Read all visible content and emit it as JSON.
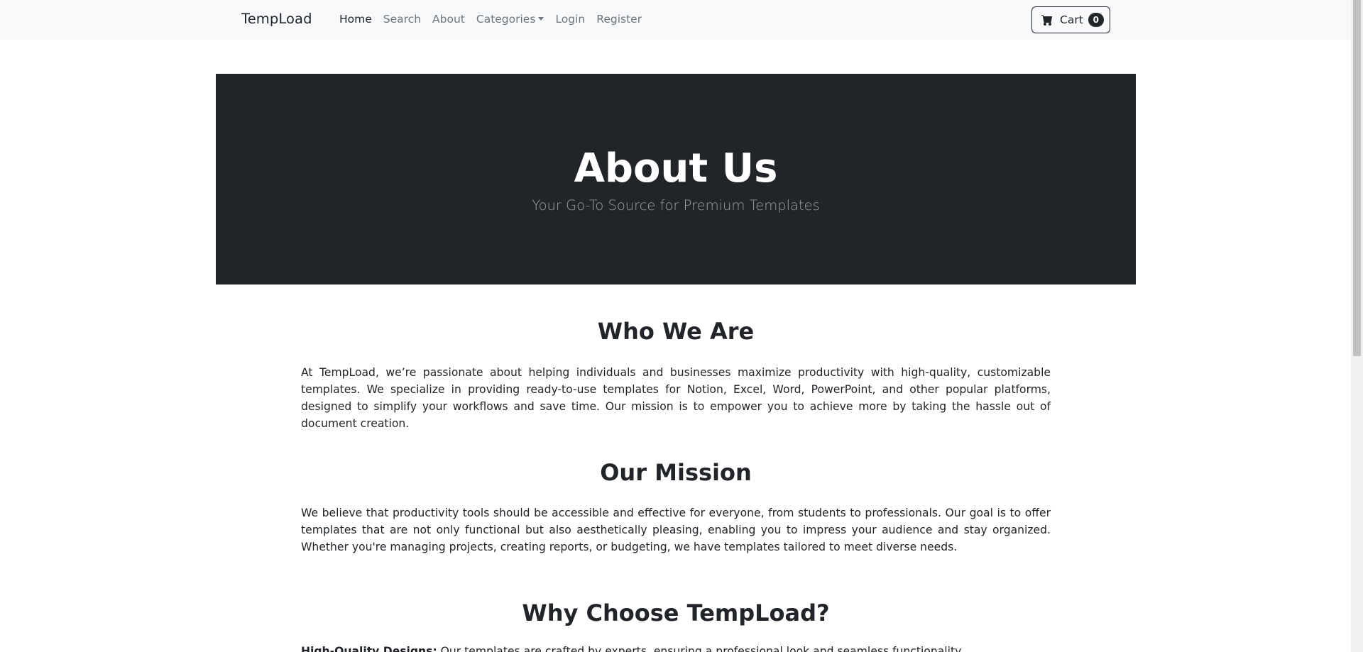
{
  "navbar": {
    "brand": "TempLoad",
    "links": [
      {
        "label": "Home",
        "active": true
      },
      {
        "label": "Search",
        "active": false
      },
      {
        "label": "About",
        "active": false
      },
      {
        "label": "Categories",
        "active": false,
        "dropdown": true
      },
      {
        "label": "Login",
        "active": false
      },
      {
        "label": "Register",
        "active": false
      }
    ],
    "cart": {
      "label": "Cart",
      "count": "0",
      "icon": "cart-icon"
    }
  },
  "hero": {
    "title": "About Us",
    "subtitle": "Your Go-To Source for Premium Templates"
  },
  "sections": [
    {
      "heading": "Who We Are",
      "text": "At TempLoad, we’re passionate about helping individuals and businesses maximize productivity with high-quality, customizable templates. We specialize in providing ready-to-use templates for Notion, Excel, Word, PowerPoint, and other popular platforms, designed to simplify your workflows and save time. Our mission is to empower you to achieve more by taking the hassle out of document creation."
    },
    {
      "heading": "Our Mission",
      "text": "We believe that productivity tools should be accessible and effective for everyone, from students to professionals. Our goal is to offer templates that are not only functional but also aesthetically pleasing, enabling you to impress your audience and stay organized. Whether you're managing projects, creating reports, or budgeting, we have templates tailored to meet diverse needs."
    },
    {
      "heading": "Why Choose TempLoad?",
      "item_title": "High-Quality Designs:",
      "item_text": " Our templates are crafted by experts, ensuring a professional look and seamless functionality."
    }
  ],
  "colors": {
    "navbar_bg": "#f8f9fa",
    "hero_bg": "#212529",
    "text": "#212529",
    "muted": "#6c757d"
  }
}
